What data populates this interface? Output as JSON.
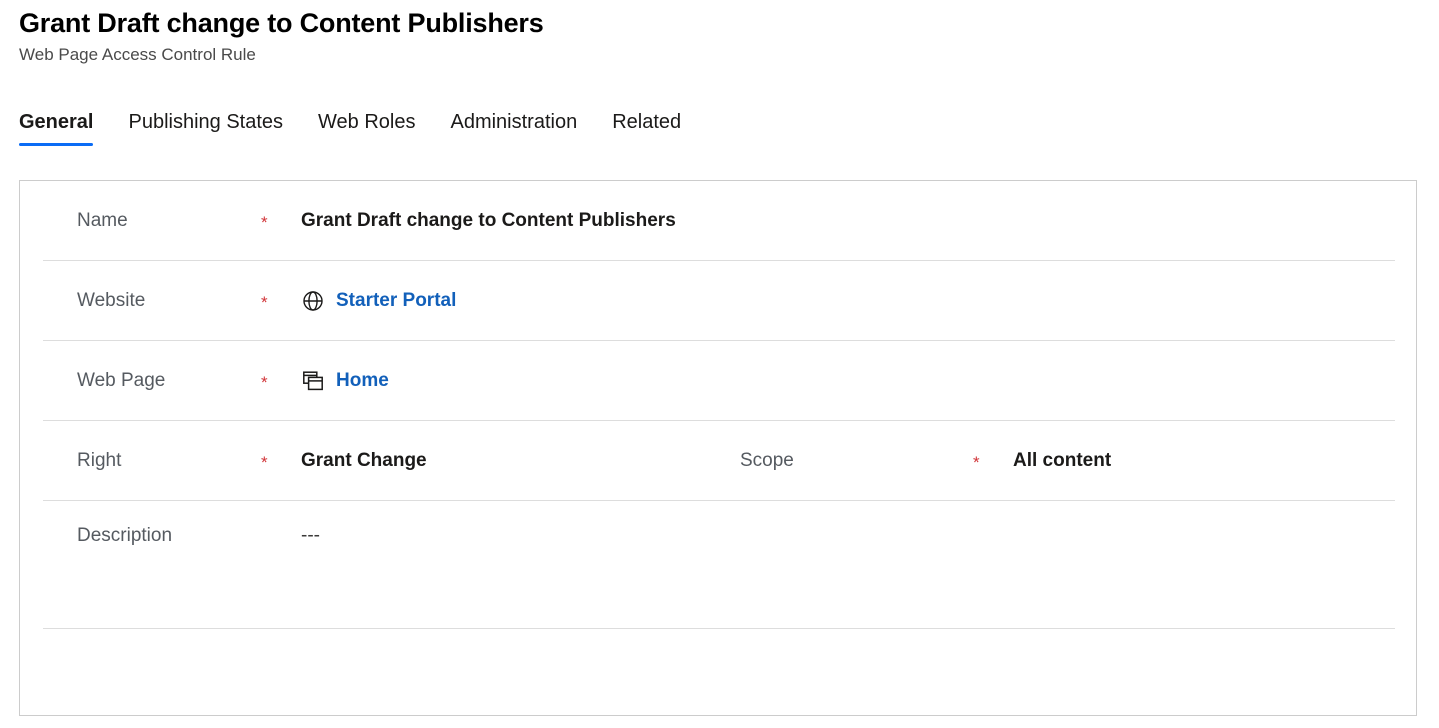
{
  "header": {
    "title": "Grant Draft change to Content Publishers",
    "subtitle": "Web Page Access Control Rule"
  },
  "tabs": [
    {
      "label": "General",
      "active": true
    },
    {
      "label": "Publishing States",
      "active": false
    },
    {
      "label": "Web Roles",
      "active": false
    },
    {
      "label": "Administration",
      "active": false
    },
    {
      "label": "Related",
      "active": false
    }
  ],
  "form": {
    "required_marker": "*",
    "rows": {
      "name": {
        "label": "Name",
        "value": "Grant Draft change to Content Publishers"
      },
      "website": {
        "label": "Website",
        "value": "Starter Portal",
        "icon": "globe-icon"
      },
      "webpage": {
        "label": "Web Page",
        "value": "Home",
        "icon": "web-page-icon"
      },
      "right": {
        "label": "Right",
        "value": "Grant Change"
      },
      "scope": {
        "label": "Scope",
        "value": "All content"
      },
      "description": {
        "label": "Description",
        "value": "---"
      }
    }
  },
  "colors": {
    "accent": "#0a6cf5",
    "link": "#1260ba",
    "required": "#d13438",
    "label": "#555a60",
    "border": "#cccccc",
    "separator": "#dddddd"
  }
}
